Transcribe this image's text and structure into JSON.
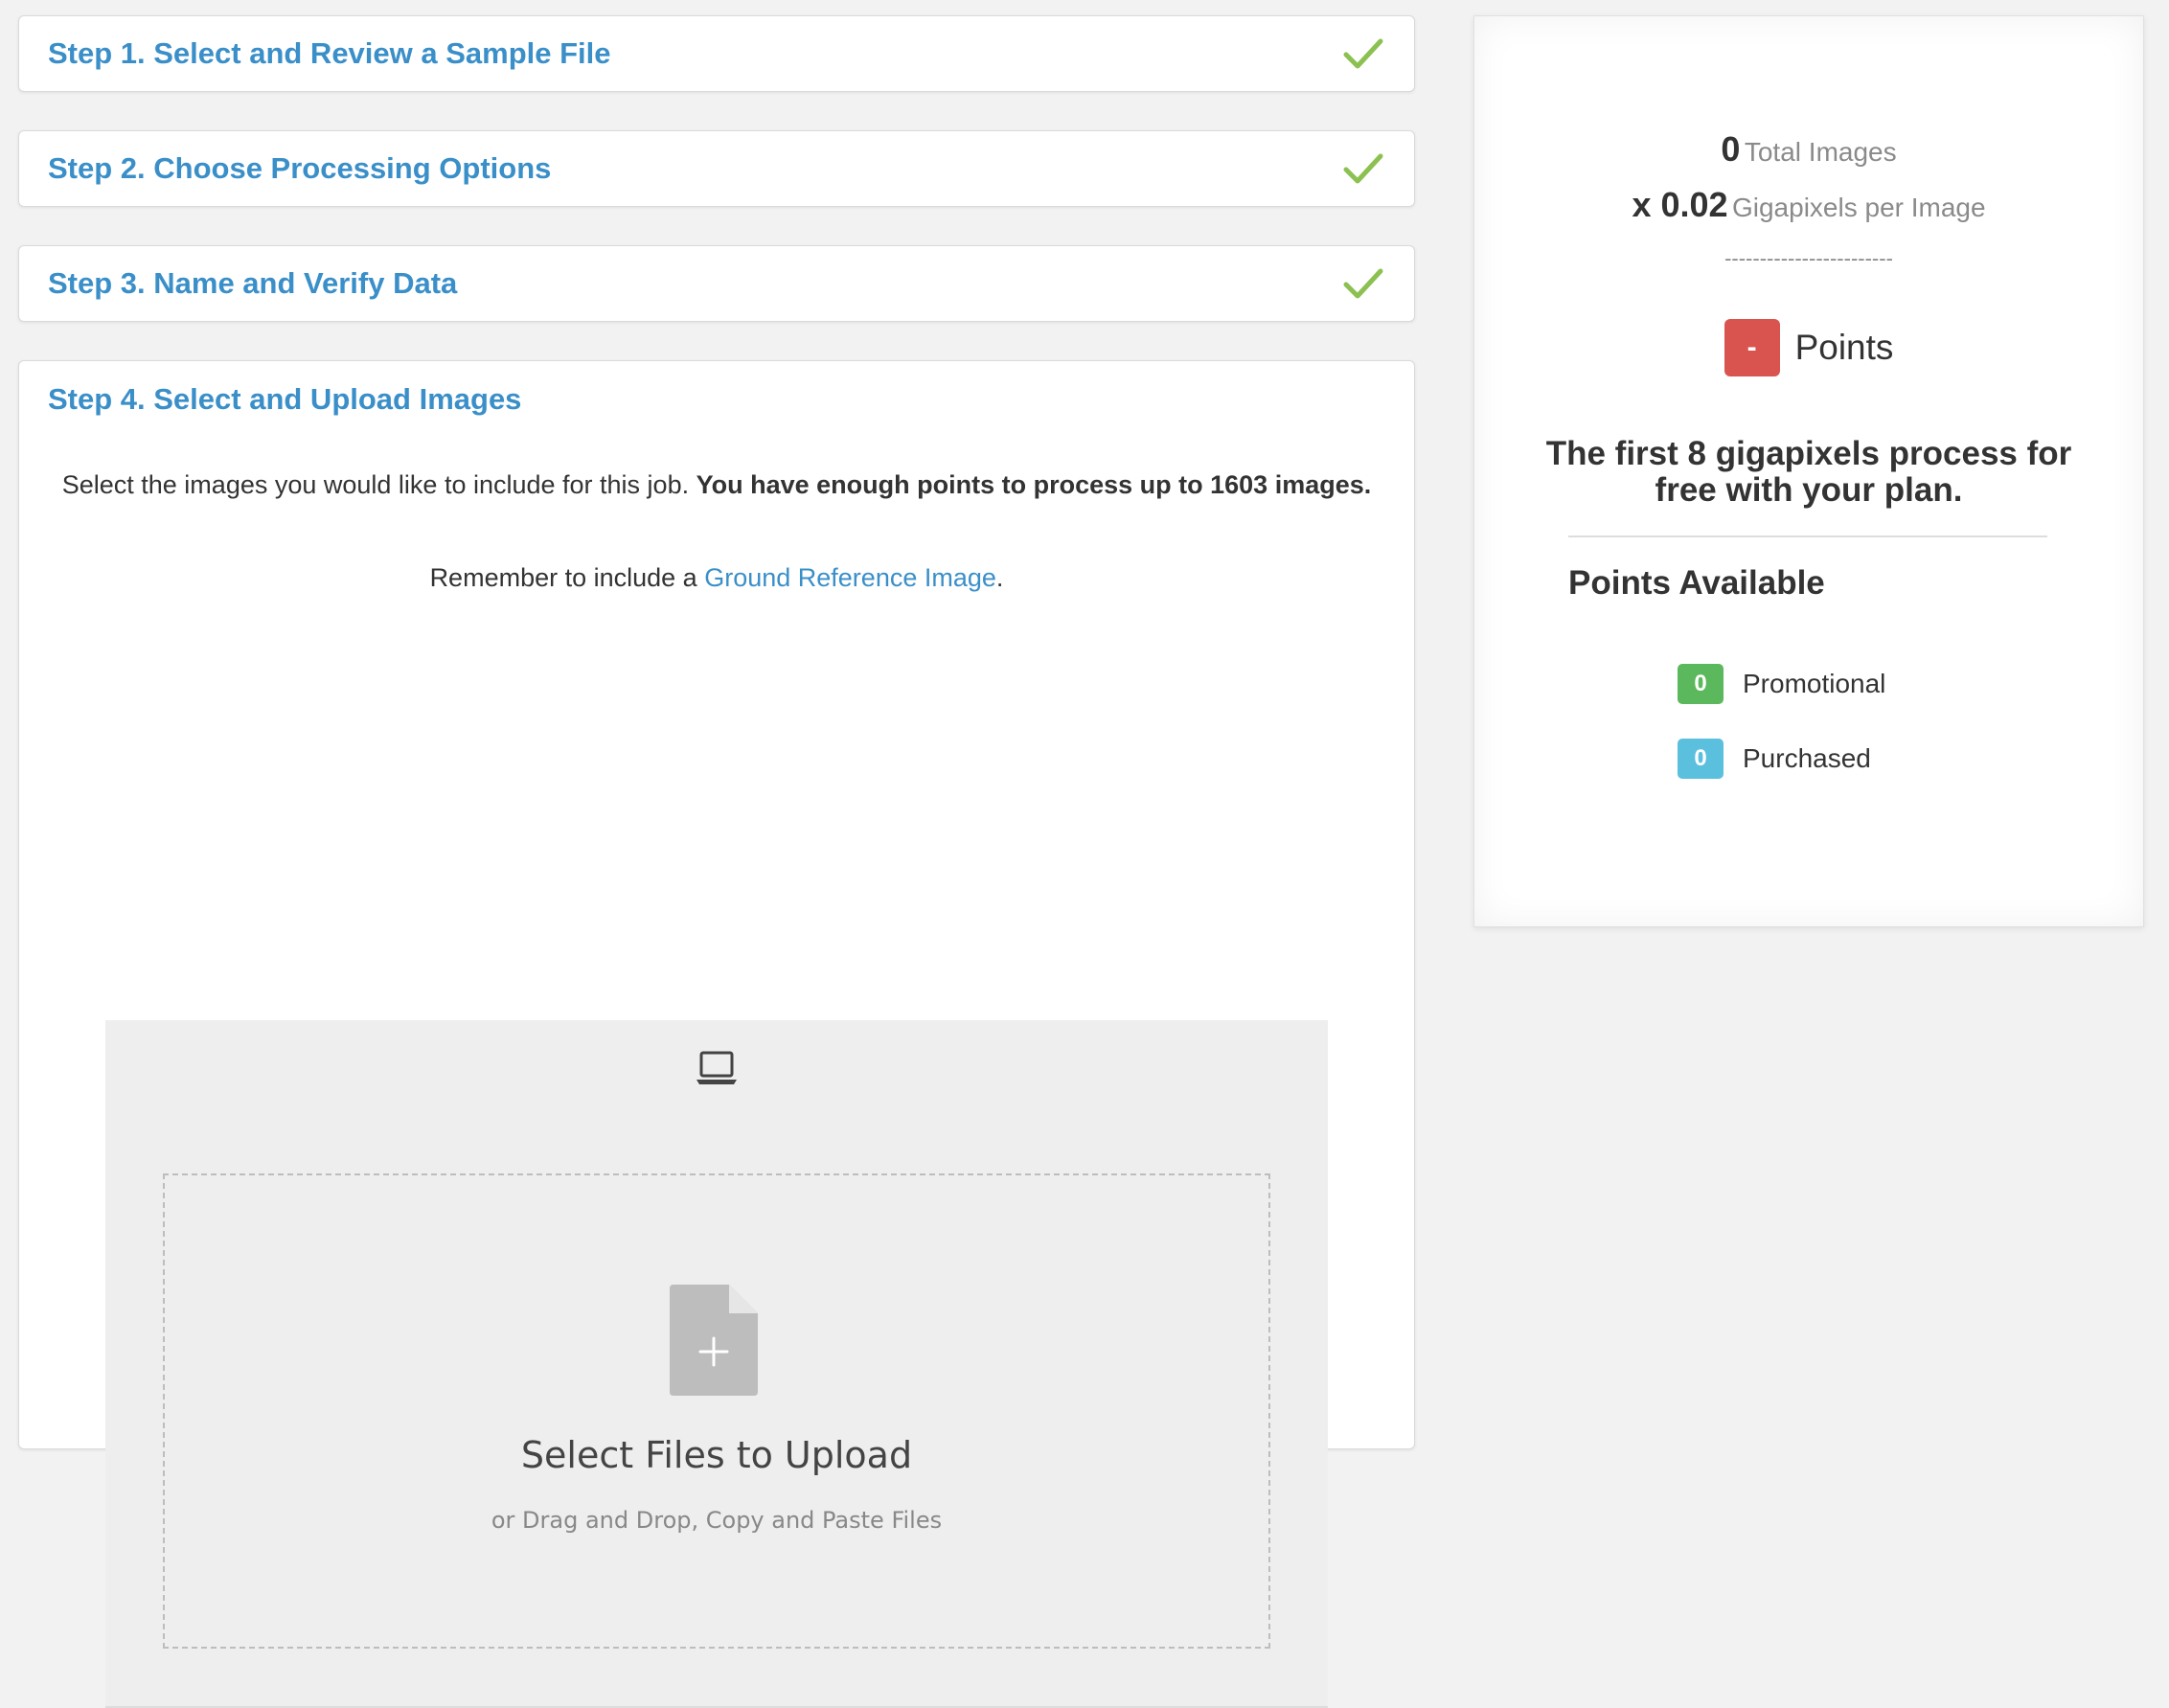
{
  "steps": [
    {
      "label": "Step 1. Select and Review a Sample File",
      "complete": true
    },
    {
      "label": "Step 2. Choose Processing Options",
      "complete": true
    },
    {
      "label": "Step 3. Name and Verify Data",
      "complete": true
    },
    {
      "label": "Step 4. Select and Upload Images",
      "complete": false
    }
  ],
  "step4": {
    "intro_text": "Select the images you would like to include for this job.",
    "intro_bold": "You have enough points to process up to 1603 images.",
    "remember_prefix": "Remember to include a",
    "remember_link": "Ground Reference Image",
    "remember_suffix": ".",
    "upload": {
      "title": "Select Files to Upload",
      "hint": "or Drag and Drop, Copy and Paste Files"
    }
  },
  "summary": {
    "total_images_value": "0",
    "total_images_label": "Total Images",
    "gigapixels_value": "x 0.02",
    "gigapixels_label": "Gigapixels per Image",
    "separator": "------------------------",
    "points_badge": "-",
    "points_label": "Points",
    "free_text_pre": "The first",
    "free_text_amount": "8",
    "free_text_unit": "gigapixels",
    "free_text_post": "process for free with your plan.",
    "available_heading": "Points Available",
    "available": [
      {
        "value": "0",
        "label": "Promotional",
        "color": "#5cb85c"
      },
      {
        "value": "0",
        "label": "Purchased",
        "color": "#5bc0de"
      }
    ]
  },
  "colors": {
    "link": "#3a8fc9",
    "check": "#8cc152",
    "danger": "#d9534f"
  }
}
